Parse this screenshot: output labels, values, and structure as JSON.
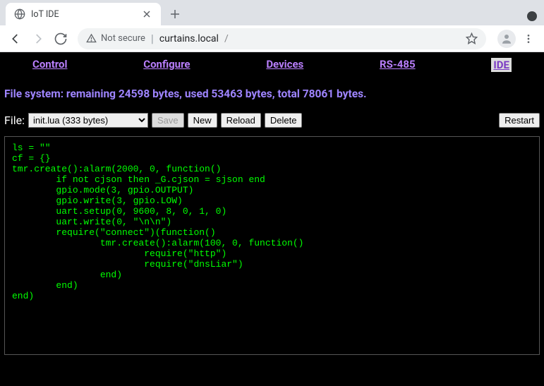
{
  "browser": {
    "tab_title": "IoT IDE",
    "security_text": "Not secure",
    "url_host": "curtains.local",
    "url_path": "/"
  },
  "nav": {
    "items": [
      {
        "label": "Control",
        "active": false
      },
      {
        "label": "Configure",
        "active": false
      },
      {
        "label": "Devices",
        "active": false
      },
      {
        "label": "RS-485",
        "active": false
      },
      {
        "label": "IDE",
        "active": true
      }
    ]
  },
  "status": "File system: remaining 24598 bytes, used 53463 bytes, total 78061 bytes.",
  "file_bar": {
    "label": "File:",
    "selected": "init.lua (333 bytes)",
    "save": "Save",
    "new": "New",
    "reload": "Reload",
    "delete": "Delete",
    "restart": "Restart"
  },
  "editor_content": "ls = \"\"\ncf = {}\ntmr.create():alarm(2000, 0, function()\n        if not cjson then _G.cjson = sjson end\n        gpio.mode(3, gpio.OUTPUT)\n        gpio.write(3, gpio.LOW)\n        uart.setup(0, 9600, 8, 0, 1, 0)\n        uart.write(0, \"\\n\\n\")\n        require(\"connect\")(function()\n                tmr.create():alarm(100, 0, function()\n                        require(\"http\")\n                        require(\"dnsLiar\")\n                end)\n        end)\nend)"
}
